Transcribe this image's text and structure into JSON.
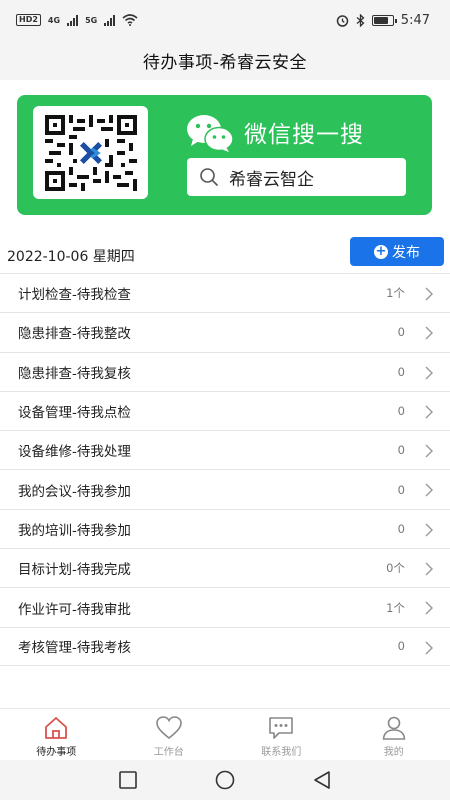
{
  "status_bar": {
    "chip": "HD",
    "chip2": "2",
    "net1": "4G",
    "net2": "5G",
    "time": "5:47"
  },
  "header": {
    "title": "待办事项-希睿云安全"
  },
  "banner": {
    "title": "微信搜一搜",
    "search_text": "希睿云智企",
    "bg_color": "#2dc15a"
  },
  "date_row": {
    "date": "2022-10-06 星期四",
    "publish_label": "发布",
    "accent": "#1a73e8"
  },
  "tasks": [
    {
      "label": "计划检查-待我检查",
      "count": "1个"
    },
    {
      "label": "隐患排查-待我整改",
      "count": "0"
    },
    {
      "label": "隐患排查-待我复核",
      "count": "0"
    },
    {
      "label": "设备管理-待我点检",
      "count": "0"
    },
    {
      "label": "设备维修-待我处理",
      "count": "0"
    },
    {
      "label": "我的会议-待我参加",
      "count": "0"
    },
    {
      "label": "我的培训-待我参加",
      "count": "0"
    },
    {
      "label": "目标计划-待我完成",
      "count": "0个"
    },
    {
      "label": "作业许可-待我审批",
      "count": "1个"
    },
    {
      "label": "考核管理-待我考核",
      "count": "0"
    }
  ],
  "tab_bar": {
    "items": [
      {
        "label": "待办事项",
        "icon": "home-icon",
        "active": true
      },
      {
        "label": "工作台",
        "icon": "heart-icon",
        "active": false
      },
      {
        "label": "联系我们",
        "icon": "chat-icon",
        "active": false
      },
      {
        "label": "我的",
        "icon": "user-icon",
        "active": false
      }
    ],
    "active_color": "#d9534f"
  },
  "nav_bar": {
    "icons": [
      "recent-apps-icon",
      "home-circle-icon",
      "back-icon"
    ]
  }
}
